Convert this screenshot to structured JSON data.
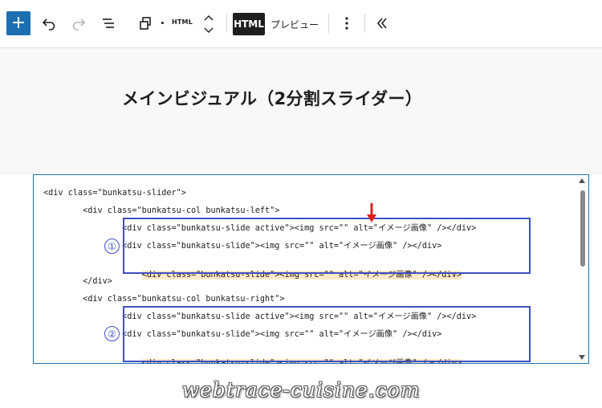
{
  "toolbar": {
    "add_label": "+",
    "html_block_label": "HTML",
    "html_tab_label": "HTML",
    "preview_tab_label": "プレビュー"
  },
  "page": {
    "heading": "メインビジュアル（2分割スライダー）"
  },
  "editor": {
    "lines": [
      "<div class=\"bunkatsu-slider\">",
      "        <div class=\"bunkatsu-col bunkatsu-left\">",
      "                <div class=\"bunkatsu-slide active\"><img src=\"\" alt=\"イメージ画像\" /></div>",
      "                <div class=\"bunkatsu-slide\"><img src=\"\" alt=\"イメージ画像\" /></div>",
      "                <div class=\"bunkatsu-slide\"><img src=\"\" alt=\"イメージ画像\" /></div>",
      "        </div>",
      "        <div class=\"bunkatsu-col bunkatsu-right\">",
      "                <div class=\"bunkatsu-slide active\"><img src=\"\" alt=\"イメージ画像\" /></div>",
      "                <div class=\"bunkatsu-slide\"><img src=\"\" alt=\"イメージ画像\" /></div>",
      "                <div class=\"bunkatsu-slide\"><img src=\"\" alt=\"イメージ画像\" /></div>"
    ]
  },
  "annotations": {
    "marker_1": "①",
    "marker_2": "②"
  },
  "watermark": "webtrace-cuisine.com",
  "colors": {
    "accent": "#1e6fb0",
    "annotation": "#3f4fc3",
    "arrow": "#e02020",
    "highlight": "#fde9c8"
  }
}
